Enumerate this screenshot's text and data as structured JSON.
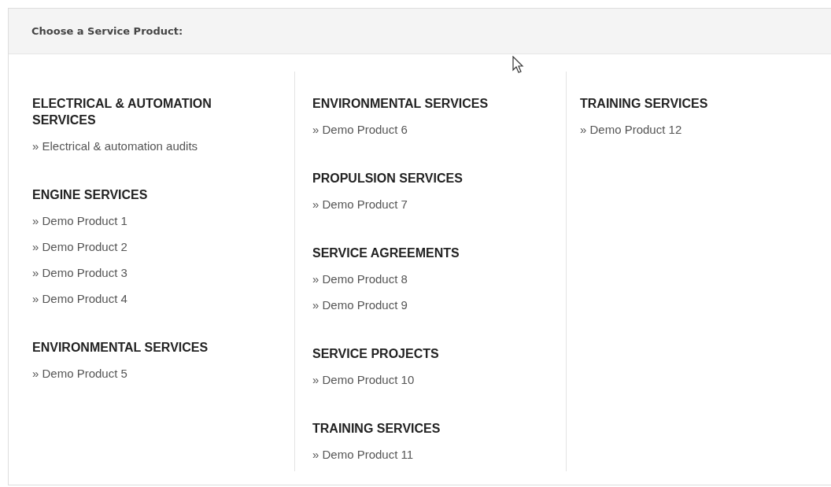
{
  "panel": {
    "title": "Choose a Service Product:"
  },
  "columns": [
    {
      "groups": [
        {
          "heading": "ELECTRICAL & AUTOMATION SERVICES",
          "links": [
            "» Electrical & automation audits"
          ]
        },
        {
          "heading": "ENGINE SERVICES",
          "links": [
            "» Demo Product 1",
            "» Demo Product 2",
            "» Demo Product 3",
            "» Demo Product 4"
          ]
        },
        {
          "heading": "ENVIRONMENTAL SERVICES",
          "links": [
            "» Demo Product 5"
          ]
        }
      ]
    },
    {
      "groups": [
        {
          "heading": "ENVIRONMENTAL SERVICES",
          "links": [
            "» Demo Product 6"
          ]
        },
        {
          "heading": "PROPULSION SERVICES",
          "links": [
            "» Demo Product 7"
          ]
        },
        {
          "heading": "SERVICE AGREEMENTS",
          "links": [
            "» Demo Product 8",
            "» Demo Product 9"
          ]
        },
        {
          "heading": "SERVICE PROJECTS",
          "links": [
            "» Demo Product 10"
          ]
        },
        {
          "heading": "TRAINING SERVICES",
          "links": [
            "» Demo Product 11"
          ]
        }
      ]
    },
    {
      "groups": [
        {
          "heading": "TRAINING SERVICES",
          "links": [
            "» Demo Product 12"
          ]
        }
      ]
    }
  ]
}
